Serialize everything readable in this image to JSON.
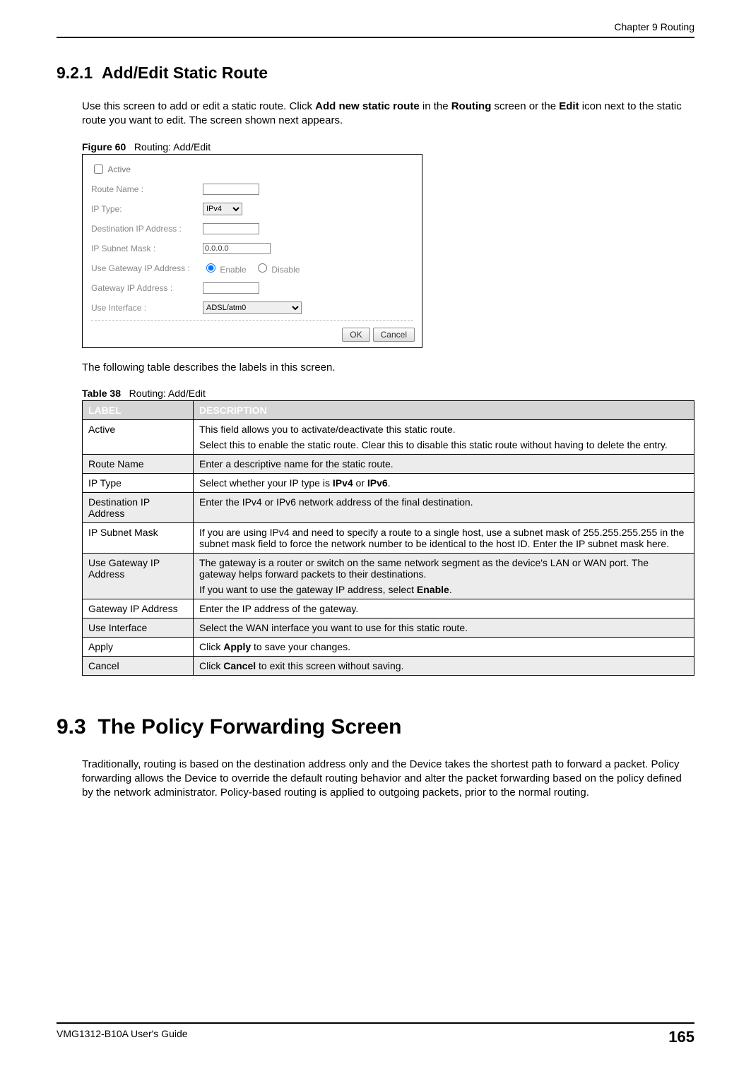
{
  "running_head": "Chapter 9 Routing",
  "section_921": {
    "number": "9.2.1",
    "title": "Add/Edit Static Route",
    "intro_pre": "Use this screen to add or edit a static route. Click ",
    "intro_bold1": "Add new static route",
    "intro_mid": " in the ",
    "intro_bold2": "Routing",
    "intro_mid2": " screen or the ",
    "intro_bold3": "Edit",
    "intro_post": " icon next to the static route you want to edit. The screen shown next appears."
  },
  "figure": {
    "label": "Figure 60",
    "caption": "Routing: Add/Edit",
    "fields": {
      "active": "Active",
      "route_name": "Route Name :",
      "ip_type": "IP Type:",
      "dest_ip": "Destination IP Address :",
      "subnet": "IP Subnet Mask :",
      "use_gw": "Use Gateway IP Address :",
      "gw_ip": "Gateway IP Address :",
      "use_if": "Use Interface :"
    },
    "values": {
      "active_checked": false,
      "route_name": "",
      "ip_type_selected": "IPv4",
      "dest_ip": "",
      "subnet": "0.0.0.0",
      "use_gw": "Enable",
      "gw_ip": "",
      "use_if_selected": "ADSL/atm0"
    },
    "radio_enable": "Enable",
    "radio_disable": "Disable",
    "ok": "OK",
    "cancel": "Cancel"
  },
  "table_intro": "The following table describes the labels in this screen.",
  "table": {
    "label": "Table 38",
    "caption": "Routing: Add/Edit",
    "head_label": "LABEL",
    "head_desc": "DESCRIPTION",
    "rows": [
      {
        "label": "Active",
        "desc_parts": [
          {
            "t": "This field allows you to activate/deactivate this static route."
          },
          {
            "t": "Select this to enable the static route. Clear this to disable this static route without having to delete the entry."
          }
        ]
      },
      {
        "label": "Route Name",
        "desc_parts": [
          {
            "t": "Enter a descriptive name for the static route."
          }
        ]
      },
      {
        "label": "IP Type",
        "desc_parts": [
          {
            "pre": "Select whether your IP type is ",
            "b1": "IPv4",
            "mid": " or ",
            "b2": "IPv6",
            "post": "."
          }
        ]
      },
      {
        "label": "Destination IP Address",
        "desc_parts": [
          {
            "t": "Enter the IPv4 or IPv6 network address of the final destination."
          }
        ]
      },
      {
        "label": "IP Subnet Mask",
        "desc_parts": [
          {
            "t": "If you are using IPv4 and need to specify a route to a single host, use a subnet mask of 255.255.255.255 in the subnet mask field to force the network number to be identical to the host ID. Enter the IP subnet mask here."
          }
        ]
      },
      {
        "label": "Use Gateway IP Address",
        "desc_parts": [
          {
            "t": "The gateway is a router or switch on the same network segment as the device's LAN or WAN port. The gateway helps forward packets to their destinations."
          },
          {
            "pre": "If you want to use the gateway IP address, select ",
            "b1": "Enable",
            "post": "."
          }
        ]
      },
      {
        "label": "Gateway IP Address",
        "desc_parts": [
          {
            "t": "Enter the IP address of the gateway."
          }
        ]
      },
      {
        "label": "Use Interface",
        "desc_parts": [
          {
            "t": "Select the WAN interface you want to use for this static route."
          }
        ]
      },
      {
        "label": "Apply",
        "desc_parts": [
          {
            "pre": "Click ",
            "b1": "Apply",
            "post": " to save your changes."
          }
        ]
      },
      {
        "label": "Cancel",
        "desc_parts": [
          {
            "pre": "Click ",
            "b1": "Cancel",
            "post": " to exit this screen without saving."
          }
        ]
      }
    ]
  },
  "section_93": {
    "number": "9.3",
    "title": "The Policy Forwarding Screen",
    "body": "Traditionally, routing is based on the destination address only and the Device takes the shortest path to forward a packet. Policy forwarding allows the Device to override the default routing behavior and alter the packet forwarding based on the policy defined by the network administrator. Policy-based routing is applied to outgoing packets, prior to the normal routing."
  },
  "footer": {
    "guide": "VMG1312-B10A User's Guide",
    "page": "165"
  }
}
